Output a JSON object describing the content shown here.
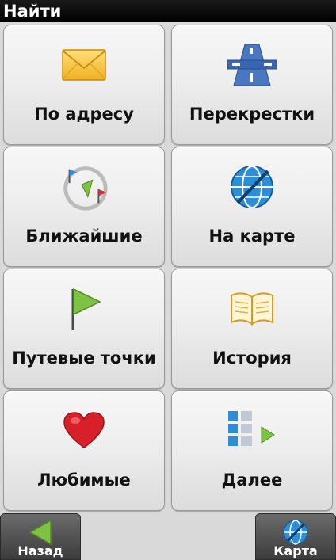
{
  "header": {
    "title": "Найти"
  },
  "tiles": [
    {
      "label": "По адресу",
      "icon": "envelope-icon"
    },
    {
      "label": "Перекрестки",
      "icon": "highway-icon"
    },
    {
      "label": "Ближайшие",
      "icon": "nearby-flags-icon"
    },
    {
      "label": "На карте",
      "icon": "globe-icon"
    },
    {
      "label": "Путевые точки",
      "icon": "waypoint-flag-icon"
    },
    {
      "label": "История",
      "icon": "open-book-icon"
    },
    {
      "label": "Любимые",
      "icon": "heart-icon"
    },
    {
      "label": "Далее",
      "icon": "more-list-icon"
    }
  ],
  "bottombar": {
    "back_label": "Назад",
    "map_label": "Карта"
  },
  "colors": {
    "title_bg": "#000000",
    "tile_bg": "#eeeeee",
    "nav_bg": "#4a4a4a",
    "accent_green": "#7dc242",
    "accent_blue": "#2a8fd8"
  }
}
